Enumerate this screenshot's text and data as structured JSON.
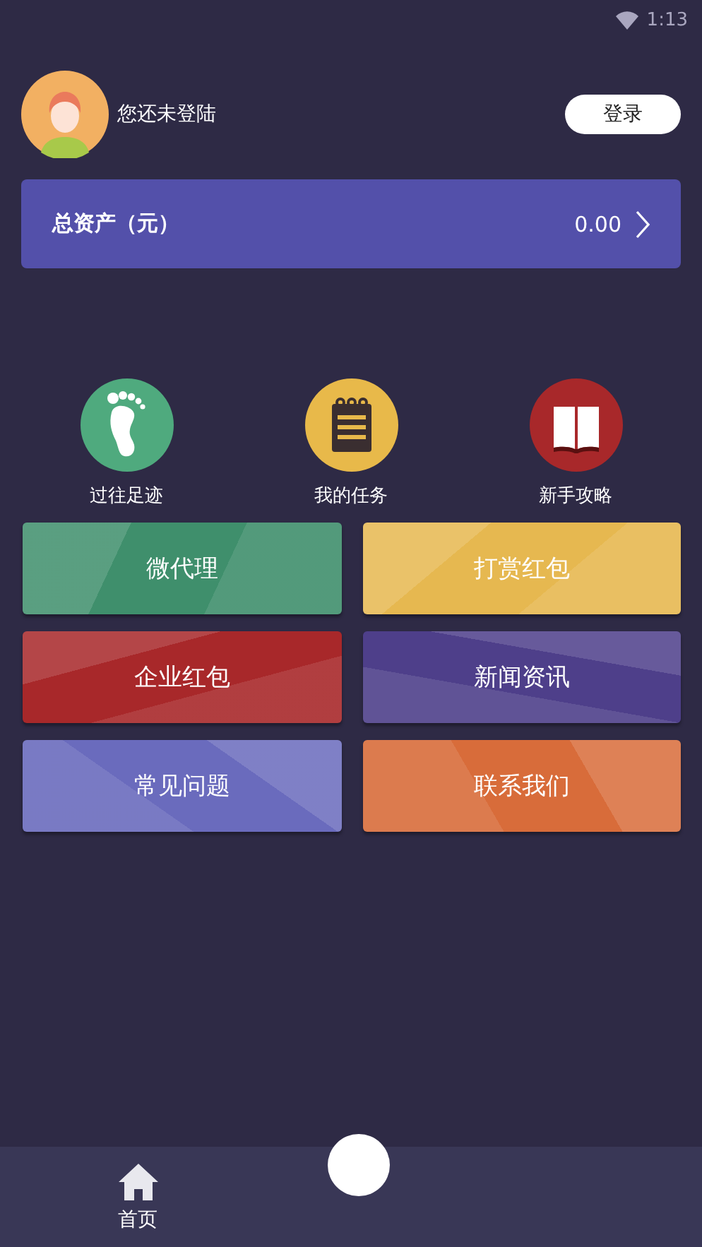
{
  "status_bar": {
    "time": "1:13"
  },
  "profile": {
    "status_text": "您还未登陆",
    "login_button": "登录"
  },
  "assets": {
    "label": "总资产（元）",
    "value": "0.00"
  },
  "shortcuts": [
    {
      "label": "过往足迹",
      "kind": "footprint",
      "color": "#4faa7e"
    },
    {
      "label": "我的任务",
      "kind": "notepad",
      "color": "#e8b94a"
    },
    {
      "label": "新手攻略",
      "kind": "book",
      "color": "#a8282a"
    }
  ],
  "tiles": [
    {
      "label": "微代理",
      "color": "#3f8f6c"
    },
    {
      "label": "打赏红包",
      "color": "#e6b850"
    },
    {
      "label": "企业红包",
      "color": "#a8282a"
    },
    {
      "label": "新闻资讯",
      "color": "#4e3f8a"
    },
    {
      "label": "常见问题",
      "color": "#6a6bbd"
    },
    {
      "label": "联系我们",
      "color": "#d86c3a"
    }
  ],
  "bottom_nav": {
    "items": [
      {
        "label": "首页"
      }
    ]
  }
}
